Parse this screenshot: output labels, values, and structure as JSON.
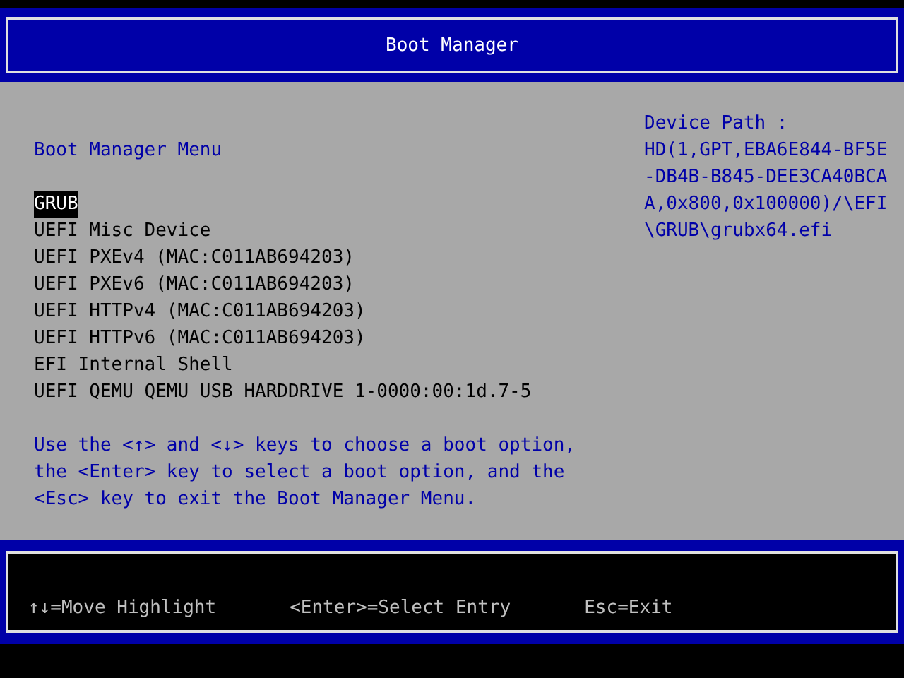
{
  "header": {
    "title": "Boot Manager"
  },
  "menu": {
    "title": "Boot Manager Menu",
    "items": [
      {
        "label": "GRUB",
        "selected": true
      },
      {
        "label": "UEFI Misc Device",
        "selected": false
      },
      {
        "label": "UEFI PXEv4 (MAC:C011AB694203)",
        "selected": false
      },
      {
        "label": "UEFI PXEv6 (MAC:C011AB694203)",
        "selected": false
      },
      {
        "label": "UEFI HTTPv4 (MAC:C011AB694203)",
        "selected": false
      },
      {
        "label": "UEFI HTTPv6 (MAC:C011AB694203)",
        "selected": false
      },
      {
        "label": "EFI Internal Shell",
        "selected": false
      },
      {
        "label": "UEFI QEMU QEMU USB HARDDRIVE 1-0000:00:1d.7-5",
        "selected": false
      }
    ],
    "help_lines": [
      "Use the <↑> and <↓> keys to choose a boot option,",
      "the <Enter> key to select a boot option, and the",
      "<Esc> key to exit the Boot Manager Menu."
    ]
  },
  "device_path": {
    "title": "Device Path :",
    "lines": [
      "HD(1,GPT,EBA6E844-BF5E",
      "-DB4B-B845-DEE3CA40BCA",
      "A,0x800,0x100000)/\\EFI",
      "\\GRUB\\grubx64.efi"
    ]
  },
  "footer": {
    "hints": [
      "↑↓=Move Highlight",
      "<Enter>=Select Entry",
      "Esc=Exit"
    ]
  }
}
